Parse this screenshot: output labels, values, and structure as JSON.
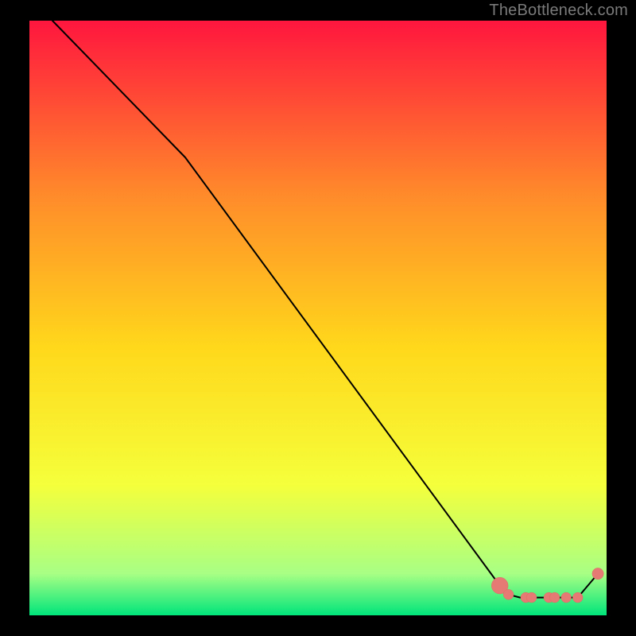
{
  "watermark": "TheBottleneck.com",
  "colors": {
    "gradient_top": "#ff163e",
    "gradient_q1": "#ff8d2a",
    "gradient_mid": "#ffd81b",
    "gradient_q3": "#f5ff3b",
    "gradient_near_bottom": "#a8ff84",
    "gradient_bottom": "#00e57b",
    "line": "#000000",
    "marker_fill": "#e47a73",
    "marker_stroke": "#e06a63",
    "background": "#000000"
  },
  "chart_data": {
    "type": "line",
    "title": "",
    "xlabel": "",
    "ylabel": "",
    "xlim": [
      0,
      100
    ],
    "ylim": [
      0,
      100
    ],
    "series": [
      {
        "name": "curve",
        "x": [
          4,
          27,
          81.5,
          83,
          85,
          87,
          89,
          91,
          93,
          95,
          98.5
        ],
        "y": [
          100,
          77,
          5,
          3.5,
          3,
          3,
          3,
          3,
          3,
          3,
          7
        ]
      }
    ],
    "markers": [
      {
        "name": "heavy-marker",
        "x": 81.5,
        "y": 5,
        "r": 2.6
      },
      {
        "name": "cluster-marker",
        "x": 83,
        "y": 3.5,
        "r": 1.6
      },
      {
        "name": "cluster-marker",
        "x": 86,
        "y": 3,
        "r": 1.6
      },
      {
        "name": "cluster-marker",
        "x": 87,
        "y": 3,
        "r": 1.6
      },
      {
        "name": "cluster-marker",
        "x": 90,
        "y": 3,
        "r": 1.6
      },
      {
        "name": "cluster-marker",
        "x": 91,
        "y": 3,
        "r": 1.6
      },
      {
        "name": "cluster-marker",
        "x": 93,
        "y": 3,
        "r": 1.6
      },
      {
        "name": "cluster-marker",
        "x": 95,
        "y": 3,
        "r": 1.6
      },
      {
        "name": "end-marker",
        "x": 98.5,
        "y": 7,
        "r": 1.8
      }
    ]
  }
}
